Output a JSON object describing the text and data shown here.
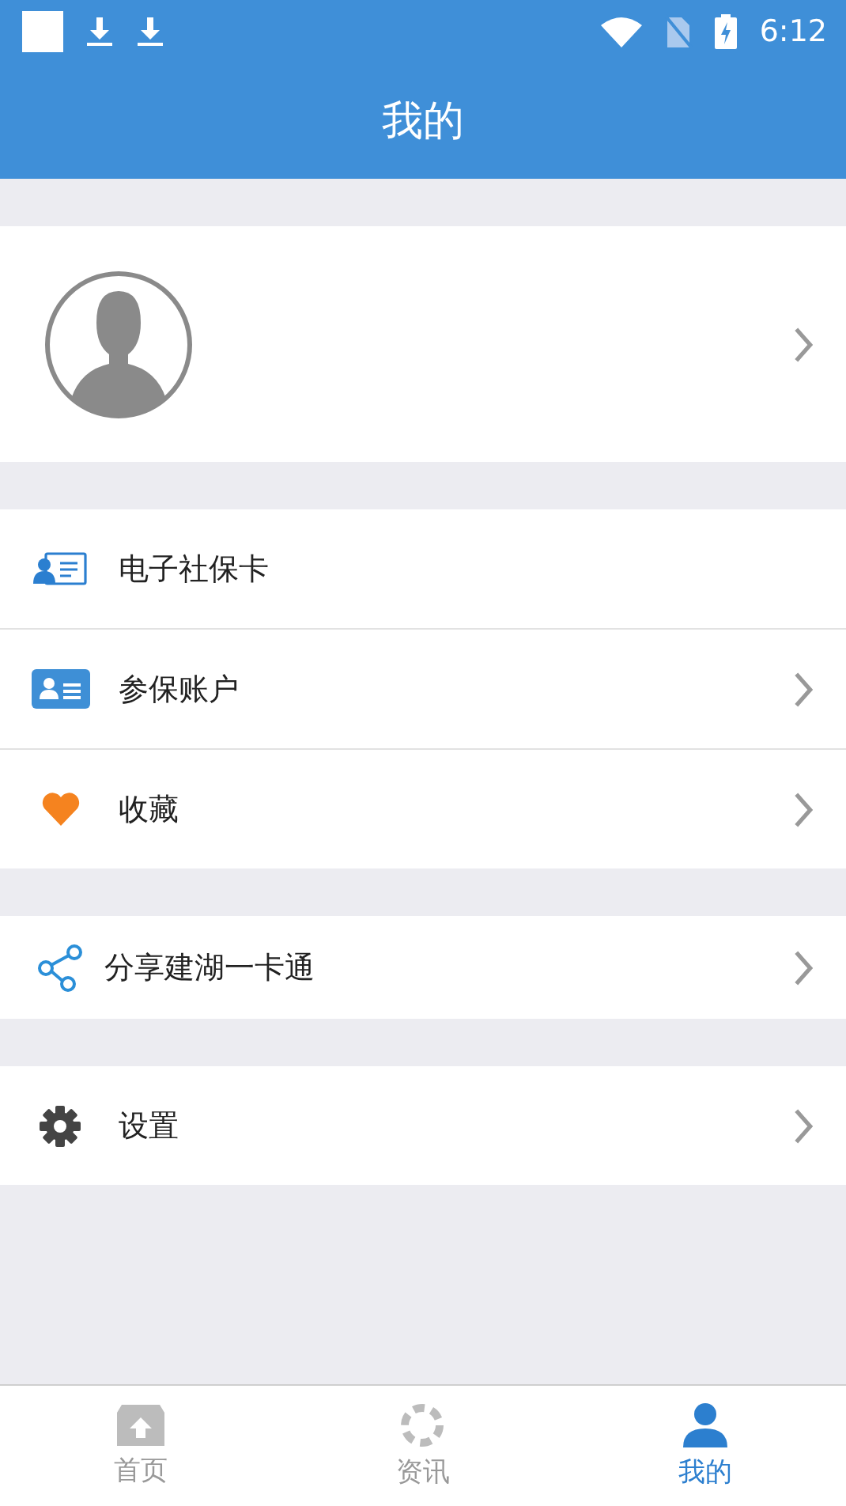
{
  "status_bar": {
    "time": "6:12"
  },
  "header": {
    "title": "我的"
  },
  "profile": {
    "chevron": true
  },
  "menu_groups": [
    {
      "items": [
        {
          "kind": "id-card",
          "label": "电子社保卡",
          "chevron": false
        },
        {
          "kind": "account-card",
          "label": "参保账户",
          "chevron": true
        },
        {
          "kind": "heart",
          "label": "收藏",
          "chevron": true
        }
      ]
    },
    {
      "items": [
        {
          "kind": "share",
          "label": "分享建湖一卡通",
          "chevron": true
        }
      ]
    },
    {
      "items": [
        {
          "kind": "gear",
          "label": "设置",
          "chevron": true
        }
      ]
    }
  ],
  "tab_bar": [
    {
      "kind": "home",
      "label": "首页",
      "selected": false
    },
    {
      "kind": "news",
      "label": "资讯",
      "selected": false
    },
    {
      "kind": "person",
      "label": "我的",
      "selected": true
    }
  ]
}
